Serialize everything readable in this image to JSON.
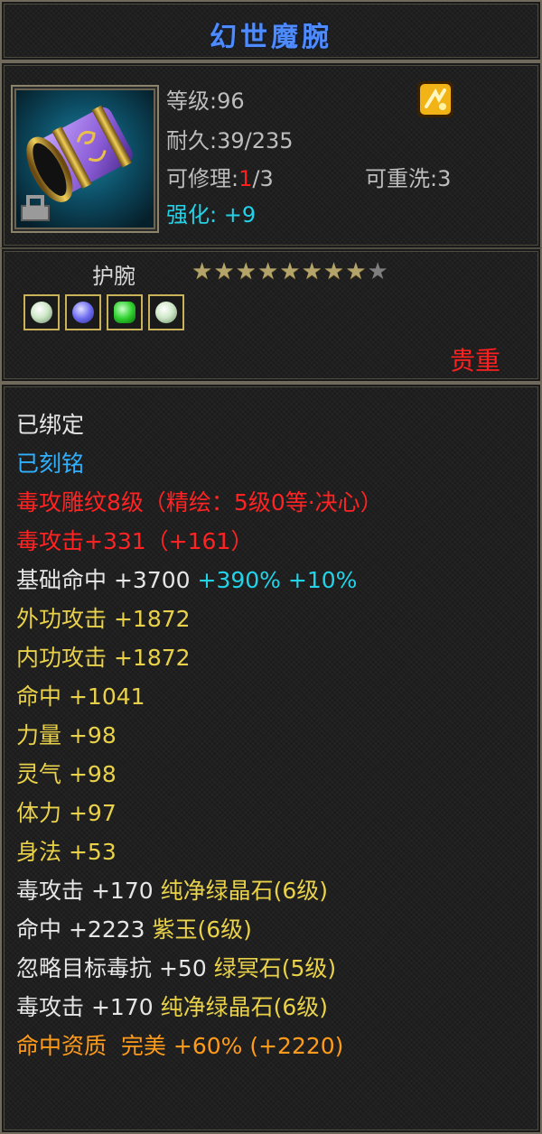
{
  "title": "幻世魔腕",
  "info": {
    "level_label": "等级",
    "level_value": "96",
    "durability_label": "耐久",
    "durability_value": "39/235",
    "repair_label": "可修理",
    "repair_current": "1",
    "repair_max": "/3",
    "rewash_label": "可重洗",
    "rewash_value": "3",
    "enhance_label": "强化",
    "enhance_value": "+9"
  },
  "bracer": {
    "type_label": "护腕",
    "stars_filled": 8,
    "stars_total": 9,
    "rarity": "贵重"
  },
  "gems": [
    {
      "icon": "pale-green-gem-icon",
      "color": "#cfe8c8"
    },
    {
      "icon": "blue-purple-gem-icon",
      "color": "#6e6cf0"
    },
    {
      "icon": "green-gem-icon",
      "color": "#2fd22f"
    },
    {
      "icon": "pale-green-gem-icon",
      "color": "#cfe8c8"
    }
  ],
  "colors": {
    "title": "#4d8bff",
    "rarity": "#ff2020",
    "white": "#e6e6e6",
    "blue": "#2fb1ff",
    "red": "#ff2323",
    "yellow": "#e9d24a",
    "cyan": "#22d3e8",
    "orange": "#ff9b1a"
  },
  "attributes": {
    "bound": "已绑定",
    "engraved": "已刻铭",
    "carving_name": "毒攻雕纹8级（",
    "carving_detail": "精绘：5级0等·决心）",
    "poison_attack_label": "毒攻击+331（",
    "poison_attack_bonus": "+161）",
    "base_hit_label": "基础命中",
    "base_hit_value": "+3700",
    "base_hit_pct1": "+390%",
    "base_hit_pct2": "+10%",
    "outer_attack_label": "外功攻击",
    "outer_attack_value": "+1872",
    "inner_attack_label": "内功攻击",
    "inner_attack_value": "+1872",
    "hit_label": "命中",
    "hit_value": "+1041",
    "strength_label": "力量",
    "strength_value": "+98",
    "spirit_label": "灵气",
    "spirit_value": "+98",
    "stamina_label": "体力",
    "stamina_value": "+97",
    "agility_label": "身法",
    "agility_value": "+53",
    "gem1_attr": "毒攻击",
    "gem1_value": "+170",
    "gem1_name": "纯净绿晶石(6级)",
    "gem2_attr": "命中",
    "gem2_value": "+2223",
    "gem2_name": "紫玉(6级)",
    "gem3_attr": "忽略目标毒抗",
    "gem3_value": "+50",
    "gem3_name": "绿冥石(5级)",
    "gem4_attr": "毒攻击",
    "gem4_value": "+170",
    "gem4_name": "纯净绿晶石(6级)",
    "quality_label": "命中资质",
    "quality_grade": "完美",
    "quality_pct": "+60%",
    "quality_bonus": "(+2220)"
  }
}
